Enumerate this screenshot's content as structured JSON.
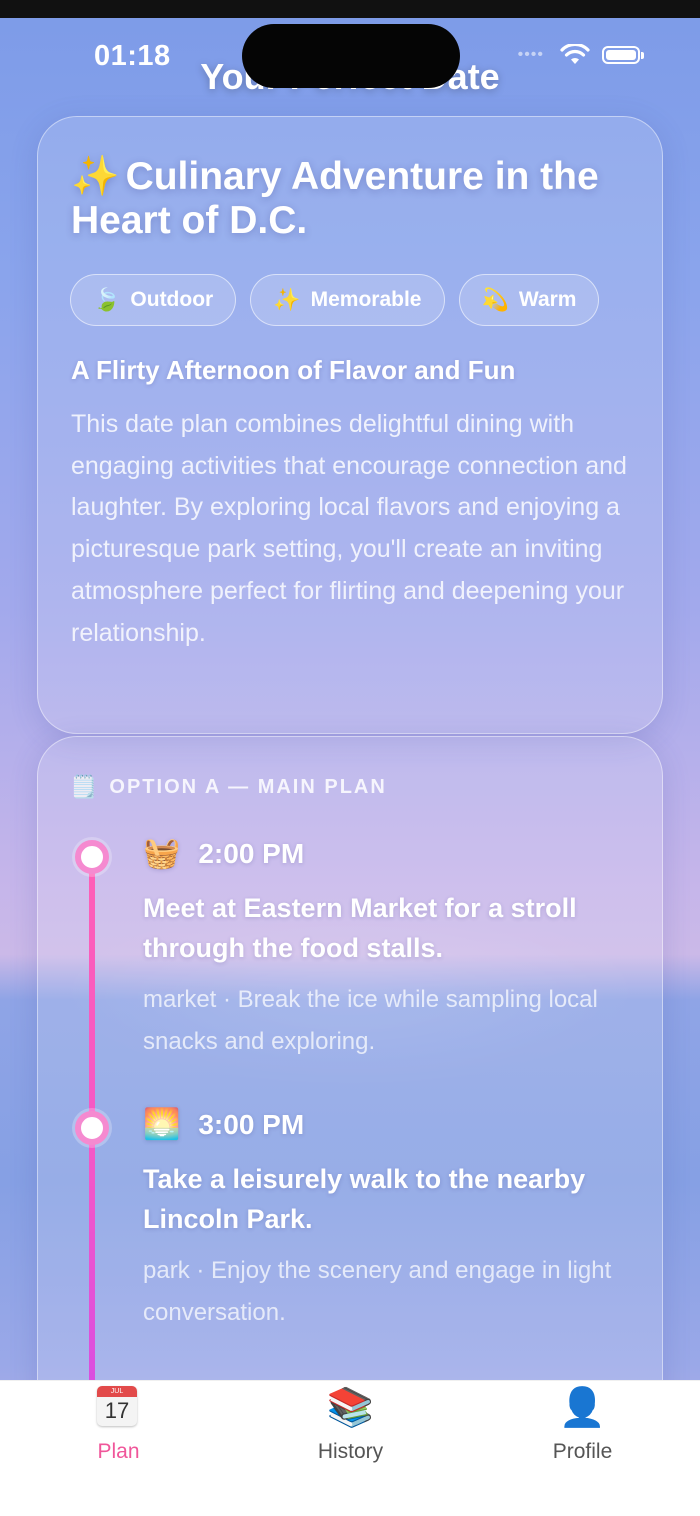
{
  "status_bar": {
    "time": "01:18"
  },
  "header": {
    "title": "Your Perfect Date"
  },
  "summary": {
    "sparkle_icon": "✨",
    "title": "Culinary Adventure in the Heart of D.C.",
    "tags": [
      {
        "icon": "🍃",
        "label": "Outdoor"
      },
      {
        "icon": "✨",
        "label": "Memorable"
      },
      {
        "icon": "💫",
        "label": "Warm"
      }
    ],
    "subtitle": "A Flirty Afternoon of Flavor and Fun",
    "description": "This date plan combines delightful dining with engaging activities that encourage connection and laughter. By exploring local flavors and enjoying a picturesque park setting, you'll create an inviting atmosphere perfect for flirting and deepening your relationship."
  },
  "plan": {
    "section_icon": "🗒️",
    "section_label": "OPTION A — MAIN PLAN",
    "steps": [
      {
        "icon": "🧺",
        "time": "2:00 PM",
        "title": "Meet at Eastern Market for a stroll through the food stalls.",
        "note": "market · Break the ice while sampling local snacks and exploring."
      },
      {
        "icon": "🌅",
        "time": "3:00 PM",
        "title": "Take a leisurely walk to the nearby Lincoln Park.",
        "note": "park · Enjoy the scenery and engage in light conversation."
      }
    ]
  },
  "tabbar": {
    "tabs": [
      {
        "label": "Plan",
        "icon": "calendar-icon",
        "active": true,
        "cal_month": "JUL",
        "cal_day": "17"
      },
      {
        "label": "History",
        "icon": "books-icon",
        "glyph": "📚"
      },
      {
        "label": "Profile",
        "icon": "person-icon",
        "glyph": "👤"
      }
    ],
    "active_color": "#f0569a"
  }
}
